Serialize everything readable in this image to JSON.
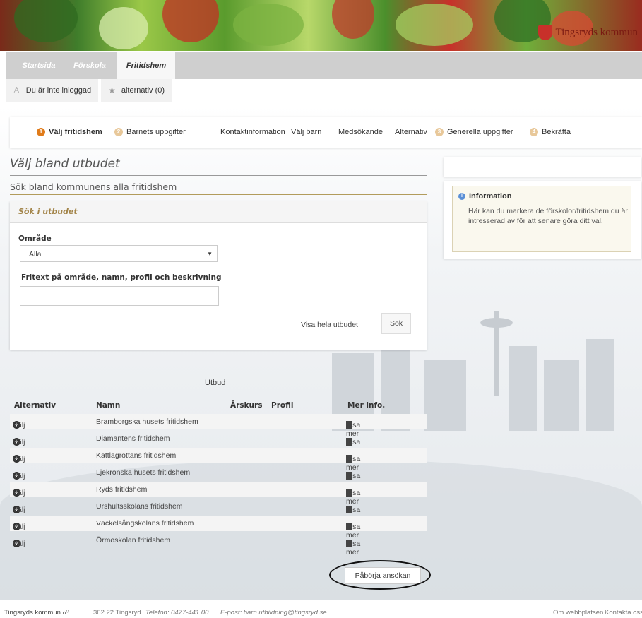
{
  "nav": {
    "tabs": [
      {
        "label": "Startsida",
        "active": false
      },
      {
        "label": "Förskola",
        "active": false
      },
      {
        "label": "Fritidshem",
        "active": true
      }
    ]
  },
  "userbar": {
    "login_status": "Du är inte inloggad",
    "alternatives": "alternativ (0)"
  },
  "steps": [
    {
      "label": "Välj fritidshem",
      "num": "1",
      "active": true
    },
    {
      "label": "Barnets uppgifter",
      "num": "2",
      "active": false
    },
    {
      "label": "Kontaktinformation",
      "num": "",
      "active": false
    },
    {
      "label": "Välj barn",
      "num": "",
      "active": false
    },
    {
      "label": "Medsökande",
      "num": "",
      "active": false
    },
    {
      "label": "Alternativ",
      "num": "",
      "active": false
    },
    {
      "label": "Generella uppgifter",
      "num": "3",
      "active": false
    },
    {
      "label": "Bekräfta",
      "num": "4",
      "active": false
    }
  ],
  "main": {
    "title": "Välj bland utbudet",
    "subtitle": "Sök bland kommunens alla fritidshem",
    "search": {
      "header": "Sök i utbudet",
      "area_label": "Område",
      "area_value": "Alla",
      "freetext_label": "Fritext på område, namn, profil och beskrivning",
      "freetext_value": "",
      "show_all": "Visa hela utbudet",
      "search_button": "Sök"
    }
  },
  "info": {
    "title": "Information",
    "text": "Här kan du markera de förskolor/fritidshem du är intresserad av för att senare göra ditt val."
  },
  "table": {
    "caption": "Utbud",
    "columns": [
      "Alternativ",
      "Namn",
      "Årskurs",
      "Profil",
      "Mer info."
    ],
    "rows": [
      {
        "select": "Välj",
        "name": "Bramborgska husets fritidshem",
        "info": "Visa mer"
      },
      {
        "select": "Välj",
        "name": "Diamantens fritidshem",
        "info": "Visa mer"
      },
      {
        "select": "Välj",
        "name": "Kattlagrottans fritidshem",
        "info": "Visa mer"
      },
      {
        "select": "Välj",
        "name": "Ljekronska husets fritidshem",
        "info": "Visa mer"
      },
      {
        "select": "Välj",
        "name": "Ryds fritidshem",
        "info": "Visa mer"
      },
      {
        "select": "Välj",
        "name": "Urshultsskolans fritidshem",
        "info": "Visa mer"
      },
      {
        "select": "Välj",
        "name": "Väckelsångskolans fritidshem",
        "info": "Visa mer"
      },
      {
        "select": "Välj",
        "name": "Örmoskolan fritidshem",
        "info": "Visa mer"
      }
    ]
  },
  "start_button": "Påbörja ansökan",
  "footer": {
    "org": "Tingsryds kommun",
    "address": "362 22 Tingsryd",
    "phone": "Telefon: 0477-441 00",
    "email": "E-post: barn.utbildning@tingsryd.se",
    "about": "Om webbplatsen",
    "contact": "Kontakta oss",
    "logo_text": "Tingsryds kommun"
  },
  "colors": {
    "accent": "#e07b1a",
    "gold": "#a3854a",
    "nav_bg": "#cfcfcf"
  }
}
